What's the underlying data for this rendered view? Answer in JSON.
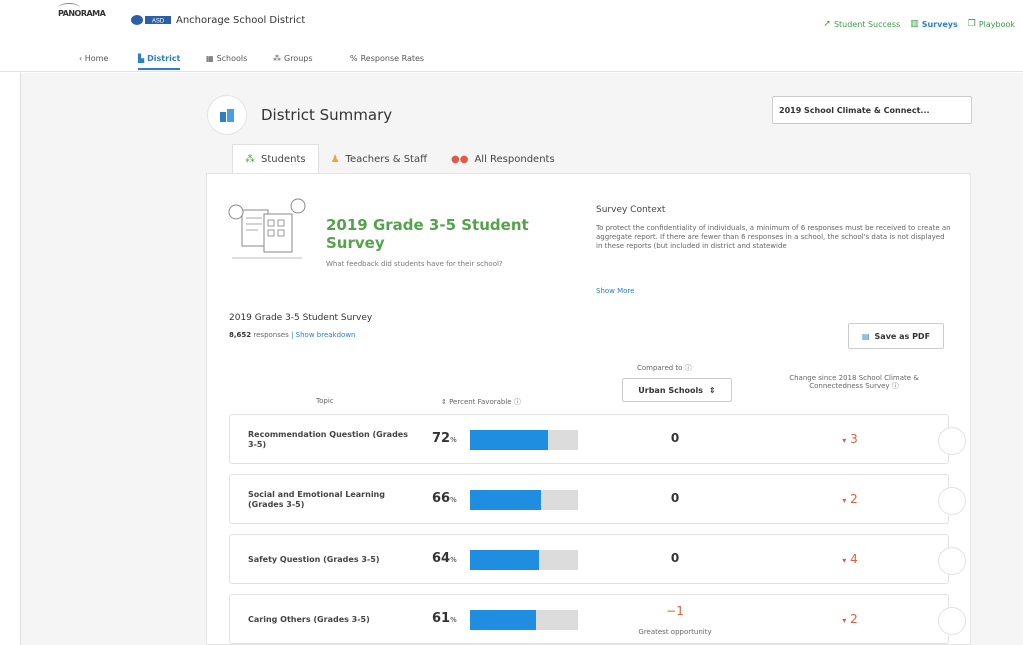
{
  "header": {
    "brand": "PANORAMA",
    "district_logo_text": "ASD",
    "district_name": "Anchorage School District",
    "links": [
      {
        "label": "Student Success",
        "icon": "trend-icon"
      },
      {
        "label": "Surveys",
        "icon": "chart-icon",
        "active": true
      },
      {
        "label": "Playbook",
        "icon": "book-icon"
      }
    ]
  },
  "subnav": {
    "home": "‹ Home",
    "district": "District",
    "schools": "Schools",
    "groups": "Groups",
    "response_rates": "Response Rates"
  },
  "summary": {
    "title": "District Summary",
    "survey_select": "2019 School Climate & Connect..."
  },
  "tabs": [
    {
      "label": "Students",
      "active": true
    },
    {
      "label": "Teachers & Staff"
    },
    {
      "label": "All Respondents"
    }
  ],
  "survey": {
    "heading": "2019 Grade 3-5 Student Survey",
    "question": "What feedback did students have for their school?",
    "context_title": "Survey Context",
    "context_body": "To protect the confidentiality of individuals, a minimum of 6 responses must be received to create an aggregate report. If there are fewer than 6 responses in a school, the school's data is not displayed in these reports (but included in district and statewide",
    "show_more": "Show More",
    "subtitle": "2019 Grade 3-5 Student Survey",
    "responses_count": "8,652",
    "responses_label": "responses",
    "show_breakdown": "| Show breakdown",
    "save_pdf": "Save as PDF"
  },
  "table": {
    "col_topic": "Topic",
    "col_pct": "⇕ Percent Favorable ⓘ",
    "col_compared": "Compared to ⓘ",
    "compare_value": "Urban Schools",
    "col_change": "Change since 2018 School Climate & Connectedness Survey ⓘ",
    "rows": [
      {
        "topic": "Recommendation Question (Grades 3-5)",
        "pct": "72",
        "pct_unit": "%",
        "fill": 0.72,
        "compared": "0",
        "change": "3",
        "change_arrow": "▾"
      },
      {
        "topic": "Social and Emotional Learning (Grades 3-5)",
        "pct": "66",
        "pct_unit": "%",
        "fill": 0.66,
        "compared": "0",
        "change": "2",
        "change_arrow": "▾"
      },
      {
        "topic": "Safety Question (Grades 3-5)",
        "pct": "64",
        "pct_unit": "%",
        "fill": 0.64,
        "compared": "0",
        "change": "4",
        "change_arrow": "▾"
      },
      {
        "topic": "Caring Others (Grades 3-5)",
        "pct": "61",
        "pct_unit": "%",
        "fill": 0.61,
        "compared": "−1",
        "compared_note": "Greatest opportunity",
        "change": "2",
        "change_arrow": "▾"
      }
    ]
  }
}
